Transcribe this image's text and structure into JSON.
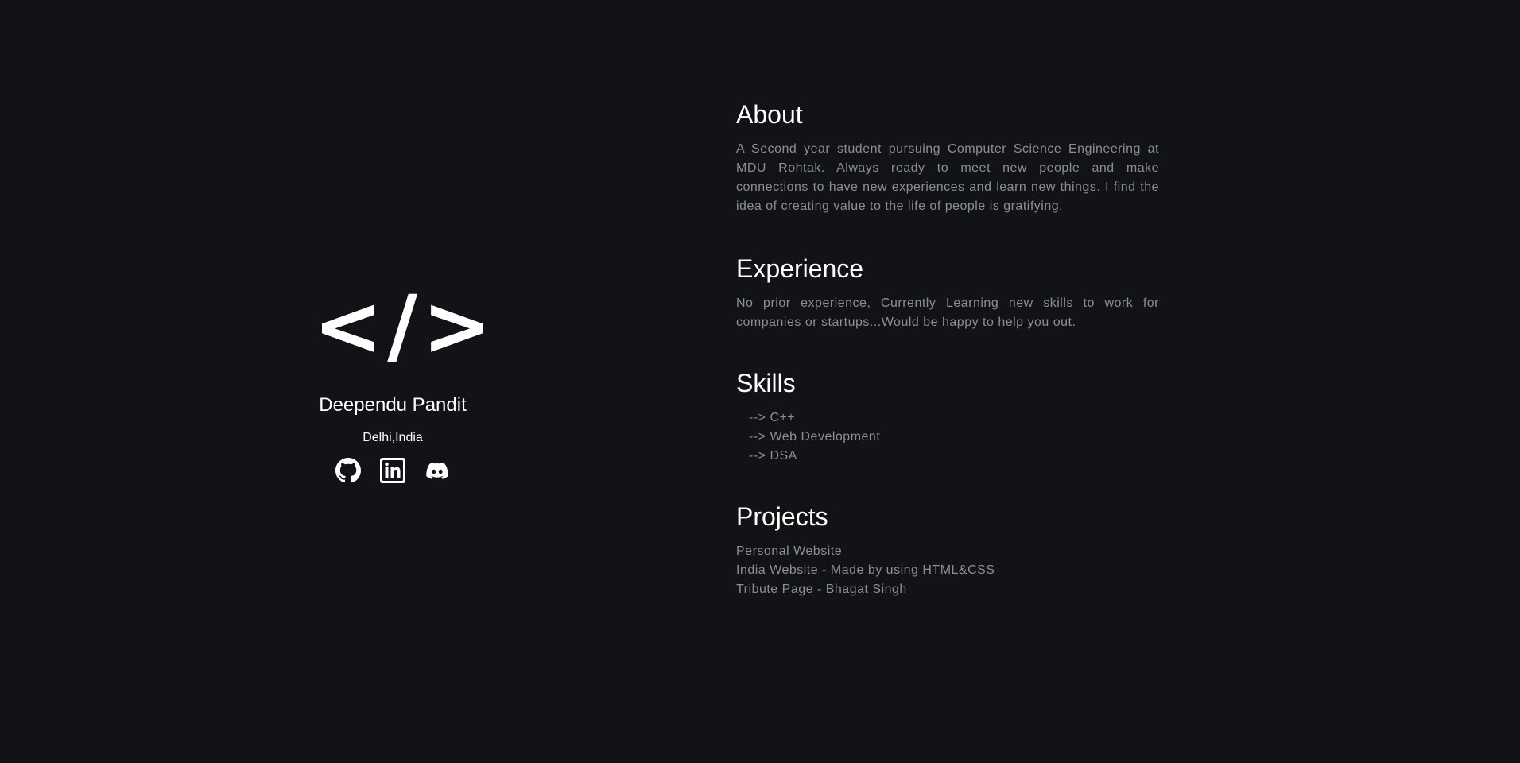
{
  "profile": {
    "logo_text": "</>",
    "name": "Deependu Pandit",
    "location": "Delhi,India",
    "socials": [
      {
        "icon": "github-icon"
      },
      {
        "icon": "linkedin-icon"
      },
      {
        "icon": "discord-icon"
      }
    ]
  },
  "about": {
    "heading": "About",
    "text": "A Second year student pursuing Computer Science Engineering at MDU Rohtak. Always ready to meet new people and make connections to have new experiences and learn new things. I find the idea of creating value to the life of people is gratifying."
  },
  "experience": {
    "heading": "Experience",
    "text": "No prior experience, Currently Learning new skills to work for companies or startups...Would be happy to help you out."
  },
  "skills": {
    "heading": "Skills",
    "items": [
      "--> C++",
      "--> Web Development",
      "--> DSA"
    ]
  },
  "projects": {
    "heading": "Projects",
    "items": [
      "Personal Website",
      "India Website - Made by using HTML&CSS",
      "Tribute Page - Bhagat Singh"
    ]
  },
  "colors": {
    "background": "#111316",
    "heading": "#ffffff",
    "body_text": "#8b8f94"
  }
}
